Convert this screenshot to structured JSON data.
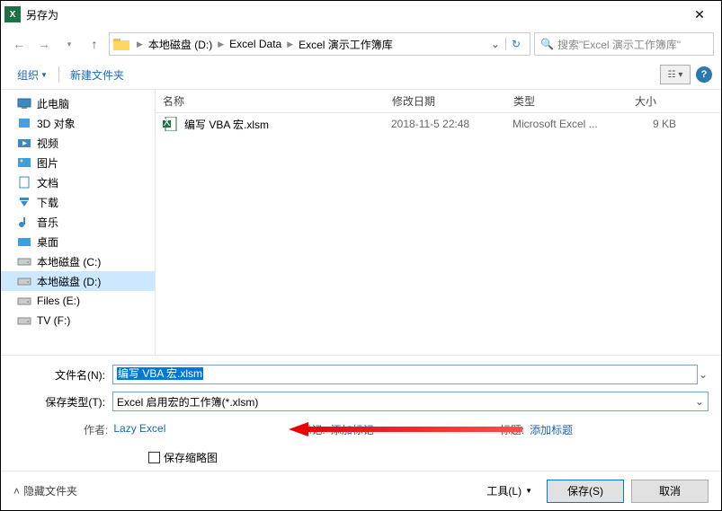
{
  "title": "另存为",
  "breadcrumb": [
    "本地磁盘 (D:)",
    "Excel Data",
    "Excel 演示工作簿库"
  ],
  "search_placeholder": "搜索\"Excel 演示工作簿库\"",
  "toolbar": {
    "organize": "组织",
    "newfolder": "新建文件夹"
  },
  "sidebar": [
    {
      "label": "此电脑",
      "icon": "pc"
    },
    {
      "label": "3D 对象",
      "icon": "3d"
    },
    {
      "label": "视频",
      "icon": "video"
    },
    {
      "label": "图片",
      "icon": "pic"
    },
    {
      "label": "文档",
      "icon": "doc"
    },
    {
      "label": "下载",
      "icon": "down"
    },
    {
      "label": "音乐",
      "icon": "music"
    },
    {
      "label": "桌面",
      "icon": "desk"
    },
    {
      "label": "本地磁盘 (C:)",
      "icon": "drive"
    },
    {
      "label": "本地磁盘 (D:)",
      "icon": "drive",
      "sel": true
    },
    {
      "label": "Files (E:)",
      "icon": "drive"
    },
    {
      "label": "TV (F:)",
      "icon": "drive"
    }
  ],
  "columns": {
    "name": "名称",
    "date": "修改日期",
    "type": "类型",
    "size": "大小"
  },
  "files": [
    {
      "name": "编写 VBA 宏.xlsm",
      "date": "2018-11-5 22:48",
      "type": "Microsoft Excel ...",
      "size": "9 KB"
    }
  ],
  "form": {
    "filename_label": "文件名(N):",
    "filename_value": "编写 VBA 宏.xlsm",
    "filetype_label": "保存类型(T):",
    "filetype_value": "Excel 启用宏的工作簿(*.xlsm)"
  },
  "meta": {
    "author_label": "作者:",
    "author_value": "Lazy Excel",
    "tag_label": "标记:",
    "tag_value": "添加标记",
    "title_label": "标题:",
    "title_value": "添加标题"
  },
  "thumb_label": "保存缩略图",
  "footer": {
    "hide": "隐藏文件夹",
    "tools": "工具(L)",
    "save": "保存(S)",
    "cancel": "取消"
  }
}
